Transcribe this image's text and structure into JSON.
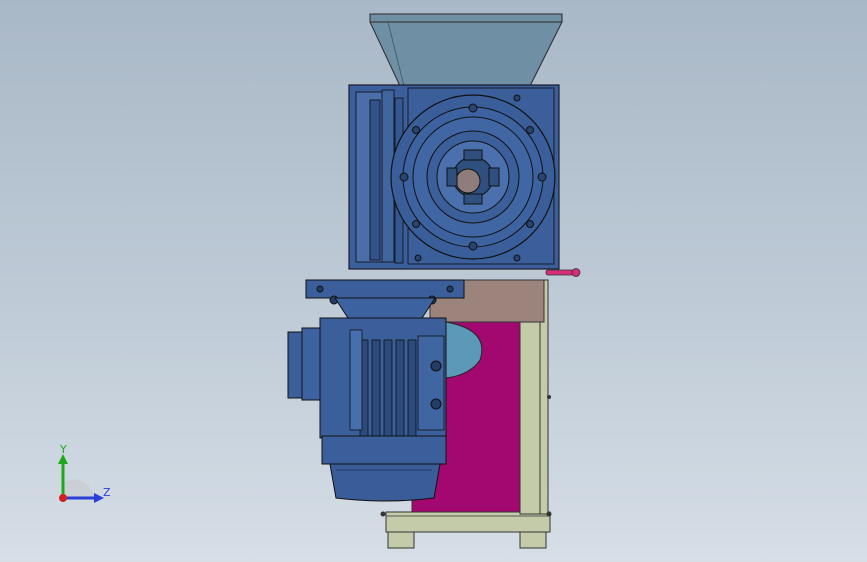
{
  "view": {
    "axis_labels": {
      "y": "Y",
      "z": "Z"
    }
  },
  "colors": {
    "background_top": "#a9b8c7",
    "background_bottom": "#d6dee6",
    "motor_blue": "#3b5f9b",
    "motor_blue_dark": "#24406f",
    "hopper": "#6f8fa4",
    "panel_magenta": "#a2086f",
    "frame_olive": "#c4cba8",
    "plate_brown": "#9c847c",
    "handle_pink": "#d62d78",
    "axis_y": "#1ea81e",
    "axis_z": "#2a3fd6",
    "axis_x": "#d61e1e"
  },
  "icons": {
    "triad": "coordinate-triad-icon"
  }
}
